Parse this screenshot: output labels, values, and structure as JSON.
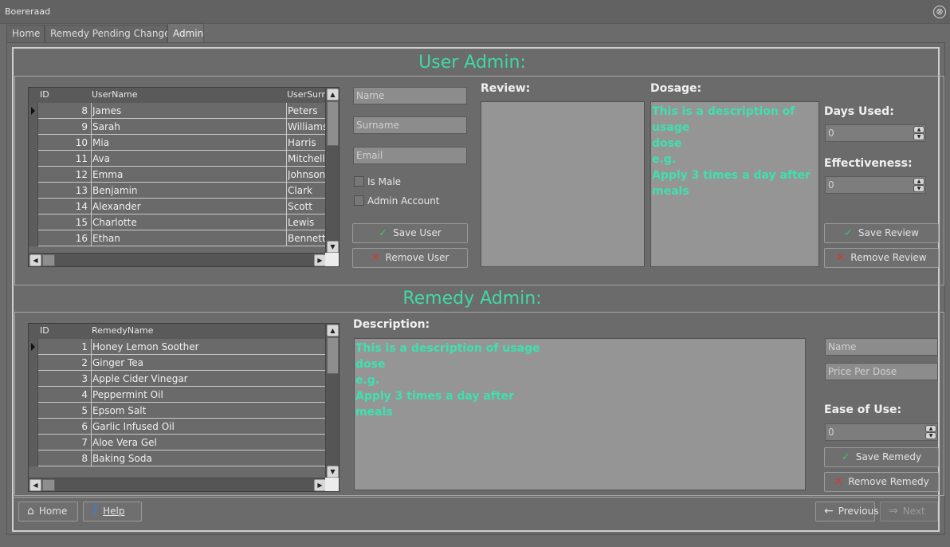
{
  "window": {
    "title": "Boereraad",
    "close_glyph": "⊗"
  },
  "tabs": [
    {
      "label": "Home"
    },
    {
      "label": "Remedy Pending Changes"
    },
    {
      "label": "Admin",
      "active": true
    }
  ],
  "user_admin": {
    "title": "User Admin:",
    "columns": [
      "ID",
      "UserName",
      "UserSurn"
    ],
    "rows": [
      {
        "id": "8",
        "name": "James",
        "surname": "Peters"
      },
      {
        "id": "9",
        "name": "Sarah",
        "surname": "Williams"
      },
      {
        "id": "10",
        "name": "Mia",
        "surname": "Harris"
      },
      {
        "id": "11",
        "name": "Ava",
        "surname": "Mitchell"
      },
      {
        "id": "12",
        "name": "Emma",
        "surname": "Johnson"
      },
      {
        "id": "13",
        "name": "Benjamin",
        "surname": "Clark"
      },
      {
        "id": "14",
        "name": "Alexander",
        "surname": "Scott"
      },
      {
        "id": "15",
        "name": "Charlotte",
        "surname": "Lewis"
      },
      {
        "id": "16",
        "name": "Ethan",
        "surname": "Bennett"
      }
    ],
    "name_placeholder": "Name",
    "surname_placeholder": "Surname",
    "email_placeholder": "Email",
    "is_male_label": "Is Male",
    "admin_account_label": "Admin Account",
    "save_label": "Save User",
    "remove_label": "Remove User",
    "review_label": "Review:",
    "dosage_label": "Dosage:",
    "dosage_text": "This is a description of usage\ndose\ne.g.\nApply 3 times a day after\nmeals",
    "days_used_label": "Days Used:",
    "days_used_value": "0",
    "effectiveness_label": "Effectiveness:",
    "effectiveness_value": "0",
    "save_review_label": "Save Review",
    "remove_review_label": "Remove Review"
  },
  "remedy_admin": {
    "title": "Remedy Admin:",
    "columns": [
      "ID",
      "RemedyName"
    ],
    "rows": [
      {
        "id": "1",
        "name": "Honey Lemon Soother"
      },
      {
        "id": "2",
        "name": "Ginger Tea"
      },
      {
        "id": "3",
        "name": "Apple Cider Vinegar"
      },
      {
        "id": "4",
        "name": "Peppermint Oil"
      },
      {
        "id": "5",
        "name": "Epsom Salt"
      },
      {
        "id": "6",
        "name": "Garlic Infused Oil"
      },
      {
        "id": "7",
        "name": "Aloe Vera Gel"
      },
      {
        "id": "8",
        "name": "Baking Soda"
      }
    ],
    "description_label": "Description:",
    "description_text": "This is a description of usage\ndose\ne.g.\nApply 3 times a day after\nmeals",
    "name_placeholder": "Name",
    "price_placeholder": "Price Per Dose",
    "ease_label": "Ease of Use:",
    "ease_value": "0",
    "save_label": "Save Remedy",
    "remove_label": "Remove Remedy"
  },
  "bottom_nav": {
    "home": "Home",
    "help": "Help",
    "previous": "Previous",
    "next": "Next"
  },
  "colors": {
    "accent": "#3fd9a6",
    "save_icon": "#3fc26f",
    "remove_icon": "#e0332b"
  }
}
